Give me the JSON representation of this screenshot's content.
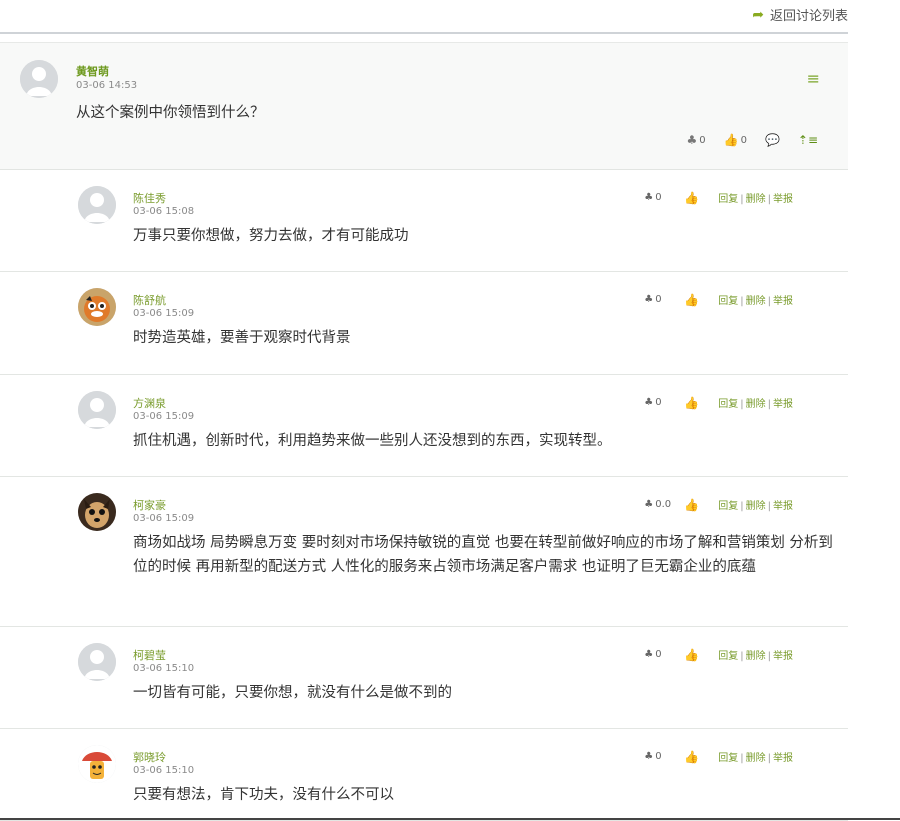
{
  "header": {
    "back_label": "返回讨论列表",
    "back_icon": "arrow-icon"
  },
  "main_post": {
    "author": "黄智萌",
    "time": "03-06 14:53",
    "content": "从这个案例中你领悟到什么？",
    "stars": "0",
    "likes": "0"
  },
  "replies": [
    {
      "author": "陈佳秀",
      "time": "03-06 15:08",
      "content": "万事只要你想做，努力去做，才有可能成功",
      "stars": "0",
      "links": [
        "回复",
        "删除",
        "举报"
      ]
    },
    {
      "author": "陈舒航",
      "time": "03-06 15:09",
      "content": "时势造英雄，要善于观察时代背景",
      "stars": "0",
      "links": [
        "回复",
        "删除",
        "举报"
      ]
    },
    {
      "author": "方渊泉",
      "time": "03-06 15:09",
      "content": "抓住机遇，创新时代，利用趋势来做一些别人还没想到的东西，实现转型。",
      "stars": "0",
      "links": [
        "回复",
        "删除",
        "举报"
      ]
    },
    {
      "author": "柯家豪",
      "time": "03-06 15:09",
      "content": "商场如战场 局势瞬息万变 要时刻对市场保持敏锐的直觉 也要在转型前做好响应的市场了解和营销策划 分析到位的时候 再用新型的配送方式 人性化的服务来占领市场满足客户需求 也证明了巨无霸企业的底蕴",
      "stars": "0.0",
      "links": [
        "回复",
        "删除",
        "举报"
      ]
    },
    {
      "author": "柯碧莹",
      "time": "03-06 15:10",
      "content": "一切皆有可能，只要你想，就没有什么是做不到的",
      "stars": "0",
      "links": [
        "回复",
        "删除",
        "举报"
      ]
    },
    {
      "author": "郭晓玲",
      "time": "03-06 15:10",
      "content": "只要有想法，肯下功夫，没有什么不可以",
      "stars": "0",
      "links": [
        "回复",
        "删除",
        "举报"
      ]
    }
  ]
}
